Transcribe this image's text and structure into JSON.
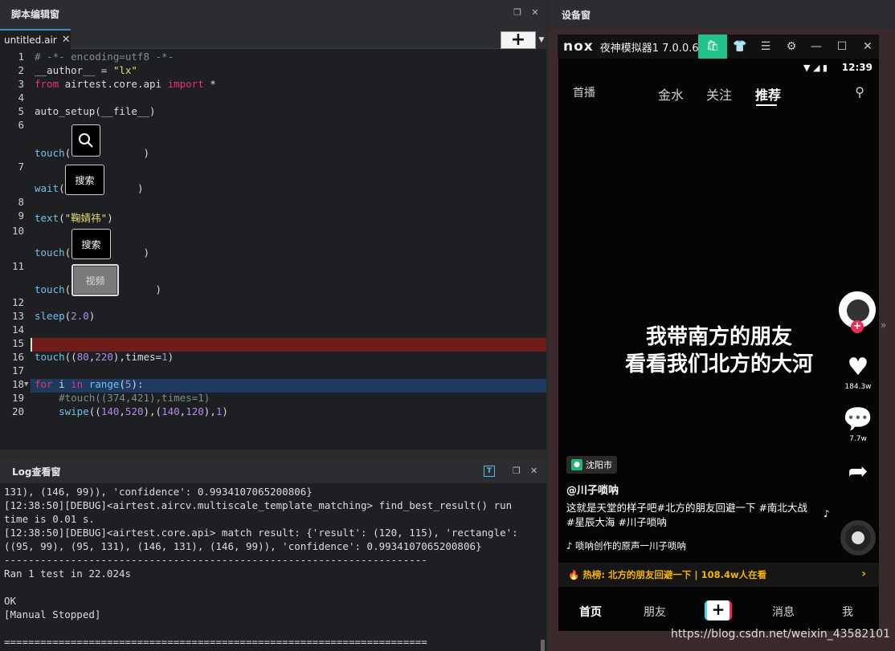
{
  "editor": {
    "title": "脚本编辑窗",
    "tab_name": "untitled.air",
    "tab_close": "✕",
    "add_label": "+",
    "lines": [
      {
        "n": "1",
        "parts": [
          [
            "c-comment",
            "# -*- encoding=utf8 -*-"
          ]
        ]
      },
      {
        "n": "2",
        "parts": [
          [
            "",
            "__author__ = "
          ],
          [
            "c-str",
            "\"lx\""
          ]
        ]
      },
      {
        "n": "3",
        "parts": [
          [
            "c-kw",
            "from"
          ],
          [
            "",
            " airtest.core.api "
          ],
          [
            "c-kw",
            "import"
          ],
          [
            "",
            " *"
          ]
        ]
      },
      {
        "n": "4",
        "parts": []
      },
      {
        "n": "5",
        "parts": [
          [
            "",
            "auto_setup(__file__)"
          ]
        ]
      },
      {
        "n": "6",
        "parts": []
      },
      {
        "n": "",
        "parts": [
          [
            "c-fn",
            "touch"
          ],
          [
            "",
            "(            )"
          ]
        ]
      },
      {
        "n": "7",
        "parts": []
      },
      {
        "n": "",
        "parts": [
          [
            "c-fn",
            "wait"
          ],
          [
            "",
            "(            )"
          ]
        ]
      },
      {
        "n": "8",
        "parts": []
      },
      {
        "n": "9",
        "parts": [
          [
            "c-fn",
            "text"
          ],
          [
            "",
            "("
          ],
          [
            "c-str",
            "\"鞠婧祎\""
          ],
          [
            "",
            ")"
          ]
        ]
      },
      {
        "n": "10",
        "parts": []
      },
      {
        "n": "",
        "parts": [
          [
            "c-fn",
            "touch"
          ],
          [
            "",
            "(            )"
          ]
        ]
      },
      {
        "n": "11",
        "parts": []
      },
      {
        "n": "",
        "parts": [
          [
            "c-fn",
            "touch"
          ],
          [
            "",
            "(              )"
          ]
        ]
      },
      {
        "n": "12",
        "parts": []
      },
      {
        "n": "13",
        "parts": [
          [
            "c-fn",
            "sleep"
          ],
          [
            "",
            "("
          ],
          [
            "c-num",
            "2.0"
          ],
          [
            "",
            ")"
          ]
        ]
      },
      {
        "n": "14",
        "parts": []
      },
      {
        "n": "15",
        "parts": []
      },
      {
        "n": "16",
        "parts": [
          [
            "c-fn",
            "touch"
          ],
          [
            "",
            "(("
          ],
          [
            "c-num",
            "80"
          ],
          [
            "",
            ","
          ],
          [
            "c-num",
            "220"
          ],
          [
            "",
            "),times="
          ],
          [
            "c-num",
            "1"
          ],
          [
            "",
            ")"
          ]
        ]
      },
      {
        "n": "17",
        "parts": []
      },
      {
        "n": "18",
        "parts": [
          [
            "c-kw",
            "for"
          ],
          [
            "",
            " i "
          ],
          [
            "c-kw",
            "in"
          ],
          [
            "",
            " "
          ],
          [
            "c-fn",
            "range"
          ],
          [
            "",
            "("
          ],
          [
            "c-num",
            "5"
          ],
          [
            "",
            "):"
          ]
        ]
      },
      {
        "n": "19",
        "parts": [
          [
            "c-comment",
            "    #touch((374,421),times=1)"
          ]
        ]
      },
      {
        "n": "20",
        "parts": [
          [
            "",
            "    "
          ],
          [
            "c-fn",
            "swipe"
          ],
          [
            "",
            "(("
          ],
          [
            "c-num",
            "140"
          ],
          [
            "",
            ","
          ],
          [
            "c-num",
            "520"
          ],
          [
            "",
            "),("
          ],
          [
            "c-num",
            "140"
          ],
          [
            "",
            ","
          ],
          [
            "c-num",
            "120"
          ],
          [
            "",
            "),"
          ],
          [
            "c-num",
            "1"
          ],
          [
            "",
            ")"
          ]
        ]
      }
    ],
    "image_labels": {
      "search_icon": "🔍",
      "search1": "搜索",
      "search2": "搜索",
      "video": "视频"
    }
  },
  "log": {
    "title": "Log查看窗",
    "lines": [
      "131), (146, 99)), 'confidence': 0.9934107065200806}",
      "[12:38:50][DEBUG]<airtest.aircv.multiscale_template_matching> find_best_result() run",
      "time is 0.01 s.",
      "[12:38:50][DEBUG]<airtest.core.api> match result: {'result': (120, 115), 'rectangle':",
      "((95, 99), (95, 131), (146, 131), (146, 99)), 'confidence': 0.9934107065200806}",
      "----------------------------------------------------------------------",
      "Ran 1 test in 22.024s",
      "",
      "OK",
      "[Manual Stopped]",
      "",
      "======================================================================"
    ]
  },
  "device": {
    "title": "设备窗",
    "nox_logo": "nox",
    "nox_title": "夜神模拟器1 7.0.0.6",
    "time": "12:39",
    "top_tabs": [
      "首播",
      "金水",
      "关注",
      "推荐"
    ],
    "caption_line1": "我带南方的朋友",
    "caption_line2": "看看我们北方的大河",
    "likes": "184.3w",
    "comments": "7.7w",
    "location": "沈阳市",
    "author": "@川子唢呐",
    "description": "这就是天堂的样子吧#北方的朋友回避一下 #南北大战 #星辰大海 #川子唢呐",
    "music": "♪ 唢呐创作的原声一川子唢呐",
    "hot_label": "热榜: 北方的朋友回避一下 | 108.4w人在看",
    "bottom_tabs": [
      "首页",
      "朋友",
      "消息",
      "我"
    ]
  },
  "watermark": "https://blog.csdn.net/weixin_43582101"
}
